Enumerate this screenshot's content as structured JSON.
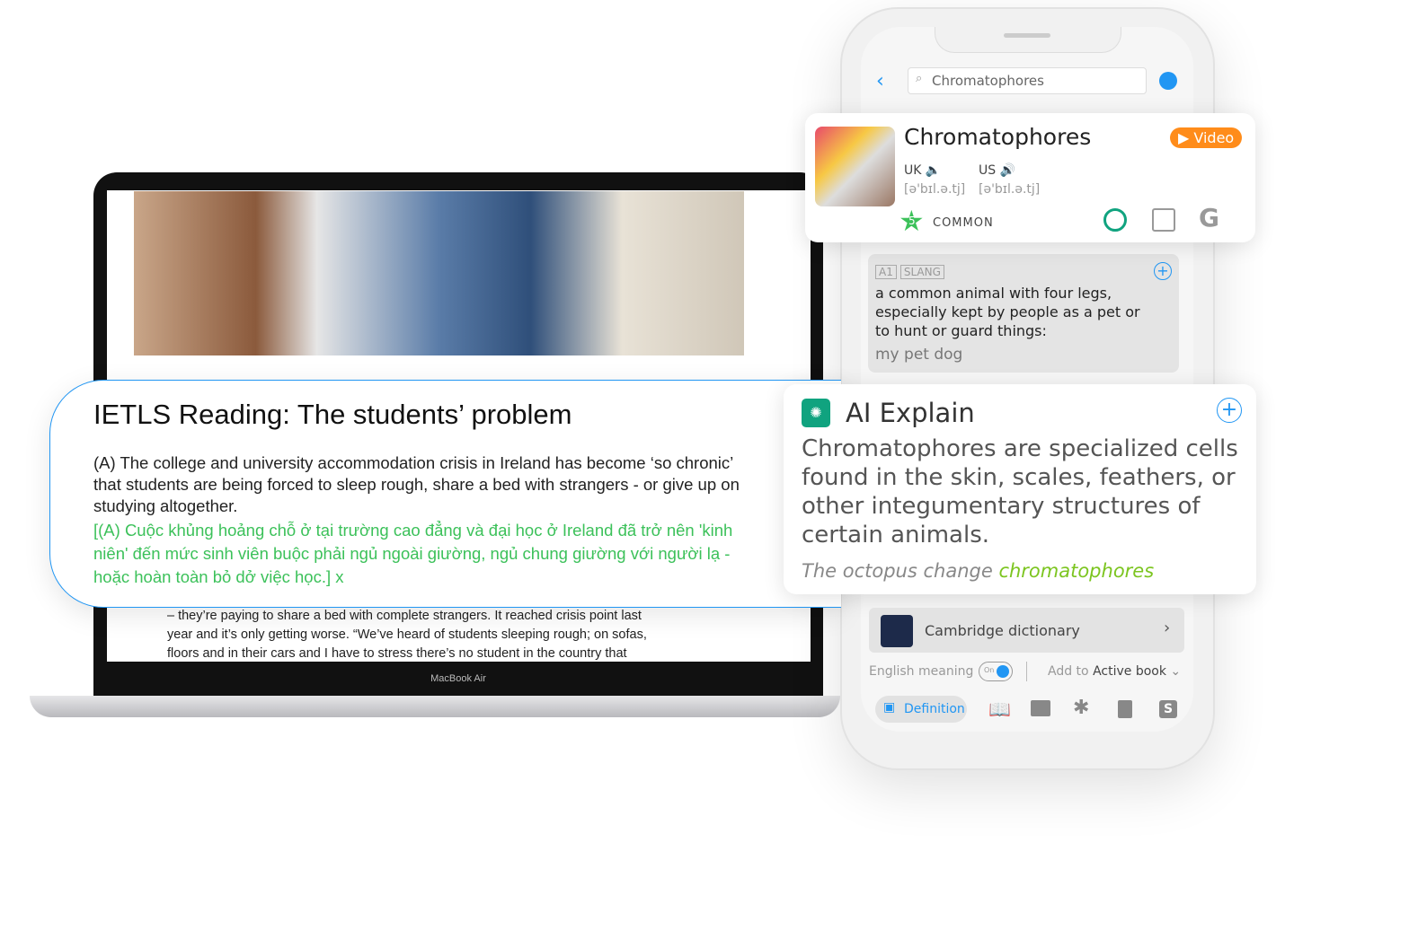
{
  "laptop": {
    "label": "MacBook Air",
    "body_lines": [
      "– they’re paying to share a bed with complete strangers. It reached crisis point last",
      "year and it’s only getting worse. “We’ve heard of students sleeping rough; on sofas,",
      "floors and in their cars and I have to stress there’s no student in the country that"
    ]
  },
  "reading": {
    "title": "IETLS Reading: The students’ problem",
    "paragraph": "(A) The college and university accommodation crisis in Ireland has become ‘so chronic’ that students are being forced to sleep rough, share a bed with strangers - or give up on studying altogether.",
    "translation": "[(A) Cuộc khủng hoảng chỗ ở tại trường cao đẳng và đại học ở Ireland đã trở nên 'kinh niên' đến mức sinh viên buộc phải ngủ ngoài giường, ngủ chung giường với người lạ - hoặc hoàn toàn bỏ dở việc học.]",
    "close": "x"
  },
  "phone": {
    "search_value": "Chromatophores"
  },
  "word": {
    "title": "Chromatophores",
    "video": "Video",
    "uk": "UK",
    "us": "US",
    "uk_ipa": "[ə'bɪl.ə.tj]",
    "us_ipa": "[ə'bɪl.ə.tj]",
    "level": "5",
    "frequency": "COMMON"
  },
  "definition": {
    "tags": [
      "A1",
      "SLANG"
    ],
    "text": "a common animal with four legs, especially kept by people as a pet or to hunt or guard things:",
    "example": "my pet dog"
  },
  "ai": {
    "title": "AI Explain",
    "text": "Chromatophores are specialized cells found in the skin, scales, feathers, or other integumentary structures of certain animals.",
    "example_prefix": "The octopus change ",
    "example_word": "chromatophores"
  },
  "dictionary": {
    "name": "Cambridge dictionary"
  },
  "options": {
    "english_meaning": "English meaning",
    "toggle": "On",
    "toggle_on": true,
    "add_to": "Add to",
    "book": "Active book"
  },
  "tabs": {
    "definition": "Definition"
  },
  "colors": {
    "accent": "#2196f3",
    "green": "#3cc15a",
    "orange": "#ff8c1a",
    "ai_green": "#10a37f"
  }
}
